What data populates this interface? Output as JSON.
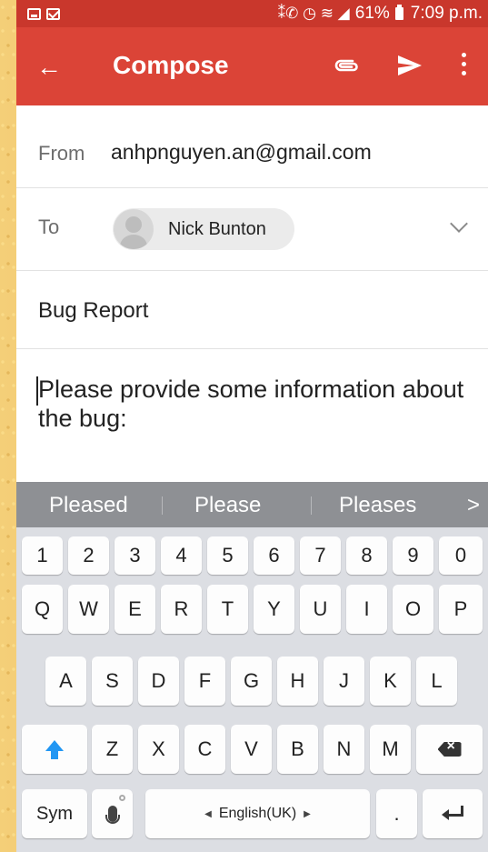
{
  "status_bar": {
    "battery_percent": "61%",
    "time": "7:09 p.m.",
    "signal_symbols": "⁑✆ ◷ ≋ ◢"
  },
  "toolbar": {
    "title": "Compose",
    "back_icon": "arrow-left-icon",
    "attach_icon": "paperclip-icon",
    "send_icon": "send-icon",
    "more_icon": "more-vertical-icon",
    "color": "#db4437"
  },
  "from": {
    "label": "From",
    "value": "anhpnguyen.an@gmail.com"
  },
  "to": {
    "label": "To",
    "recipient": "Nick Bunton"
  },
  "subject": {
    "value": "Bug Report"
  },
  "body": {
    "value": "Please provide some information about the bug:"
  },
  "suggestions": [
    "Pleased",
    "Please",
    "Pleases"
  ],
  "keyboard": {
    "number_row": [
      "1",
      "2",
      "3",
      "4",
      "5",
      "6",
      "7",
      "8",
      "9",
      "0"
    ],
    "row1": [
      "Q",
      "W",
      "E",
      "R",
      "T",
      "Y",
      "U",
      "I",
      "O",
      "P"
    ],
    "row2": [
      "A",
      "S",
      "D",
      "F",
      "G",
      "H",
      "J",
      "K",
      "L"
    ],
    "row3": [
      "Z",
      "X",
      "C",
      "V",
      "B",
      "N",
      "M"
    ],
    "sym_label": "Sym",
    "space_label": "English(UK)",
    "period_label": "."
  }
}
